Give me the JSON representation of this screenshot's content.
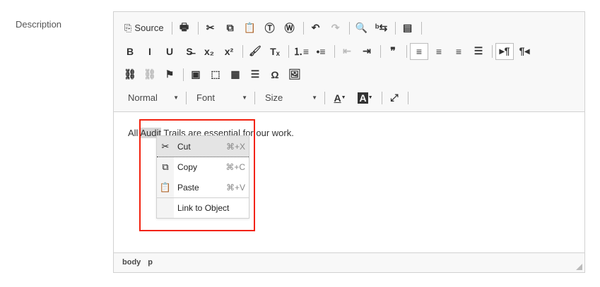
{
  "field_label": "Description",
  "toolbar": {
    "row1": [
      {
        "n": "source-button",
        "g": "⎘",
        "t": "Source"
      },
      "|",
      {
        "n": "print-icon",
        "g": "🖶"
      },
      "|",
      {
        "n": "cut-icon",
        "g": "✂"
      },
      {
        "n": "copy-icon",
        "g": "⧉"
      },
      {
        "n": "paste-icon",
        "g": "📋"
      },
      {
        "n": "paste-text-icon",
        "g": "Ⓣ"
      },
      {
        "n": "paste-word-icon",
        "g": "Ⓦ"
      },
      "|",
      {
        "n": "undo-icon",
        "g": "↶"
      },
      {
        "n": "redo-icon",
        "g": "↷",
        "d": 1
      },
      "|",
      {
        "n": "find-icon",
        "g": "🔍"
      },
      {
        "n": "replace-icon",
        "g": "ᵇ⇆"
      },
      "|",
      {
        "n": "templates-icon",
        "g": "▤"
      },
      "|"
    ],
    "row2": [
      {
        "n": "bold-icon",
        "g": "B"
      },
      {
        "n": "italic-icon",
        "g": "I"
      },
      {
        "n": "underline-icon",
        "g": "U"
      },
      {
        "n": "strikethrough-icon",
        "g": "S̶"
      },
      {
        "n": "subscript-icon",
        "g": "x₂"
      },
      {
        "n": "superscript-icon",
        "g": "x²"
      },
      "|",
      {
        "n": "copy-format-icon",
        "g": "🖌"
      },
      {
        "n": "remove-format-icon",
        "g": "Tₓ"
      },
      "|",
      {
        "n": "numbered-list-icon",
        "g": "⒈≡"
      },
      {
        "n": "bulleted-list-icon",
        "g": "•≡"
      },
      "|",
      {
        "n": "outdent-icon",
        "g": "⇤",
        "d": 1
      },
      {
        "n": "indent-icon",
        "g": "⇥"
      },
      "|",
      {
        "n": "blockquote-icon",
        "g": "❞"
      },
      "|",
      {
        "n": "align-left-icon",
        "g": "≡",
        "o": 1
      },
      {
        "n": "align-center-icon",
        "g": "≡"
      },
      {
        "n": "align-right-icon",
        "g": "≡"
      },
      {
        "n": "justify-icon",
        "g": "☰"
      },
      "|",
      {
        "n": "ltr-icon",
        "g": "▸¶",
        "o": 1
      },
      {
        "n": "rtl-icon",
        "g": "¶◂"
      }
    ],
    "row3": [
      {
        "n": "link-icon",
        "g": "⛓"
      },
      {
        "n": "unlink-icon",
        "g": "⛓",
        "d": 1
      },
      {
        "n": "anchor-icon",
        "g": "⚑"
      },
      "|",
      {
        "n": "media-icon",
        "g": "▣"
      },
      {
        "n": "iframe-icon",
        "g": "⬚"
      },
      {
        "n": "table-icon",
        "g": "▦"
      },
      {
        "n": "horizontal-line-icon",
        "g": "☰"
      },
      {
        "n": "special-char-icon",
        "g": "Ω"
      },
      {
        "n": "image-icon",
        "g": "🖼"
      }
    ],
    "format": "Normal",
    "font": "Font",
    "size": "Size",
    "text_color": "A",
    "bg_color": "A",
    "maximize": "⤢"
  },
  "content": {
    "before": "All ",
    "selected": "Audit",
    "after": " Trails are essential for our work."
  },
  "context_menu": [
    {
      "icon": "✂",
      "label": "Cut",
      "shortcut": "⌘+X"
    },
    {
      "icon": "⧉",
      "label": "Copy",
      "shortcut": "⌘+C"
    },
    {
      "icon": "📋",
      "label": "Paste",
      "shortcut": "⌘+V"
    },
    {
      "icon": "",
      "label": "Link to Object",
      "shortcut": ""
    }
  ],
  "path": [
    "body",
    "p"
  ]
}
